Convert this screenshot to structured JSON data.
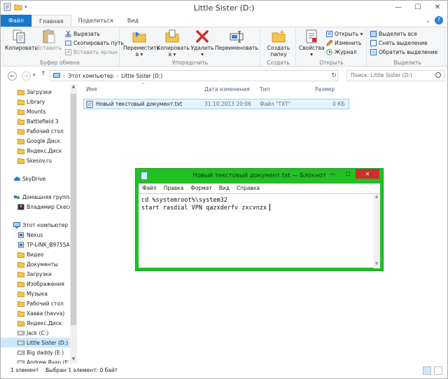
{
  "explorer": {
    "title": "Little Sister (D:)",
    "tabs": [
      "Файл",
      "Главная",
      "Поделиться",
      "Вид"
    ],
    "ribbon": {
      "clipboard": {
        "label": "Буфер обмена",
        "copy": "Копировать",
        "paste": "Вставить",
        "cut": "Вырезать",
        "copy_path": "Скопировать путь",
        "paste_shortcut": "Вставить ярлык"
      },
      "organize": {
        "label": "Упорядочить",
        "move_to": "Переместить",
        "copy_to": "Копировать",
        "to_suffix": "в ▾",
        "delete": "Удалить",
        "delete_arrow": "▾",
        "rename": "Переименовать"
      },
      "create": {
        "label": "Создать",
        "new_folder_1": "Создать",
        "new_folder_2": "папку"
      },
      "open": {
        "label": "Открыть",
        "properties": "Свойства",
        "properties_arrow": "▾",
        "open": "Открыть ▾",
        "edit": "Изменить",
        "history": "Журнал"
      },
      "select": {
        "label": "Выделить",
        "select_all": "Выделить все",
        "select_none": "Снять выделение",
        "invert": "Обратить выделение"
      }
    },
    "address": {
      "breadcrumb": [
        "Этот компьютер",
        "Little Sister (D:)"
      ],
      "search_placeholder": "Поиск: Little Sister (D:)"
    },
    "nav_items": [
      {
        "label": "Загрузки",
        "icon": "folder",
        "indent": 1
      },
      {
        "label": "Library",
        "icon": "folder",
        "indent": 1
      },
      {
        "label": "Mounts",
        "icon": "folder",
        "indent": 1
      },
      {
        "label": "Battlefield 3",
        "icon": "folder",
        "indent": 1
      },
      {
        "label": "Рабочий стол",
        "icon": "folder",
        "indent": 1
      },
      {
        "label": "Google Диск",
        "icon": "folder",
        "indent": 1
      },
      {
        "label": "Яндекс.Диск",
        "icon": "folder",
        "indent": 1
      },
      {
        "label": "Skesov.ru",
        "icon": "folder",
        "indent": 1
      },
      {
        "label": "SkyDrive",
        "icon": "cloud",
        "indent": 0
      },
      {
        "label": "Домашняя группа",
        "icon": "homegroup",
        "indent": 0
      },
      {
        "label": "Владимир Скесо",
        "icon": "user",
        "indent": 1
      },
      {
        "label": "Этот компьютер",
        "icon": "computer",
        "indent": 0
      },
      {
        "label": "Nexus",
        "icon": "device",
        "indent": 1
      },
      {
        "label": "TP-LINK_B9755A",
        "icon": "device",
        "indent": 1
      },
      {
        "label": "Видео",
        "icon": "folder",
        "indent": 1
      },
      {
        "label": "Документы",
        "icon": "folder",
        "indent": 1
      },
      {
        "label": "Загрузки",
        "icon": "folder",
        "indent": 1
      },
      {
        "label": "Изображения",
        "icon": "folder",
        "indent": 1
      },
      {
        "label": "Музыка",
        "icon": "folder",
        "indent": 1
      },
      {
        "label": "Рабочий стол",
        "icon": "folder",
        "indent": 1
      },
      {
        "label": "Хавва (havva)",
        "icon": "folder",
        "indent": 1
      },
      {
        "label": "Яндекс.Диск",
        "icon": "folder",
        "indent": 1
      },
      {
        "label": "Jack (C:)",
        "icon": "drive",
        "indent": 1
      },
      {
        "label": "Little Sister (D:)",
        "icon": "drive",
        "indent": 1,
        "selected": true
      },
      {
        "label": "Big daddy (E:)",
        "icon": "drive",
        "indent": 1
      },
      {
        "label": "Andrew Ryan (F:)",
        "icon": "drive",
        "indent": 1
      }
    ],
    "columns": {
      "name": "Имя",
      "date": "Дата изменения",
      "type": "Тип",
      "size": "Размер"
    },
    "files": [
      {
        "name": "Новый текстовый документ.txt",
        "date": "31.10.2013 20:06",
        "type": "Файл \"TXT\"",
        "size": "0 КБ"
      }
    ],
    "status": {
      "count": "1 элемент",
      "selected": "Выбран 1 элемент: 0 байт"
    }
  },
  "notepad": {
    "title": "Новый текстовый документ.txt — Блокнот",
    "menu": [
      "Файл",
      "Правка",
      "Формат",
      "Вид",
      "Справка"
    ],
    "lines": [
      "cd %systemroot%\\system32",
      "start rasdial VPN qazxderfv zxcvnzx"
    ]
  },
  "colors": {
    "notepad_frame": "#22c025",
    "file_tab": "#1979ca",
    "selection": "#cce8ff",
    "close_button": "#c7302b"
  }
}
